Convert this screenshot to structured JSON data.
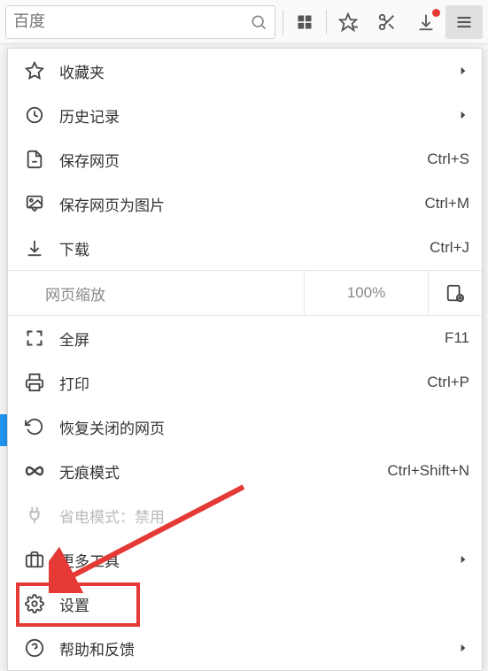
{
  "toolbar": {
    "search_placeholder": "百度"
  },
  "zoom": {
    "label": "网页缩放",
    "value": "100%"
  },
  "menu": {
    "favorites": {
      "label": "收藏夹"
    },
    "history": {
      "label": "历史记录"
    },
    "save_page": {
      "label": "保存网页",
      "shortcut": "Ctrl+S"
    },
    "save_as_image": {
      "label": "保存网页为图片",
      "shortcut": "Ctrl+M"
    },
    "downloads": {
      "label": "下载",
      "shortcut": "Ctrl+J"
    },
    "fullscreen": {
      "label": "全屏",
      "shortcut": "F11"
    },
    "print": {
      "label": "打印",
      "shortcut": "Ctrl+P"
    },
    "reopen_closed": {
      "label": "恢复关闭的网页"
    },
    "incognito": {
      "label": "无痕模式",
      "shortcut": "Ctrl+Shift+N"
    },
    "power_save": {
      "label": "省电模式：禁用"
    },
    "more_tools": {
      "label": "更多工具"
    },
    "settings": {
      "label": "设置"
    },
    "help": {
      "label": "帮助和反馈"
    }
  }
}
